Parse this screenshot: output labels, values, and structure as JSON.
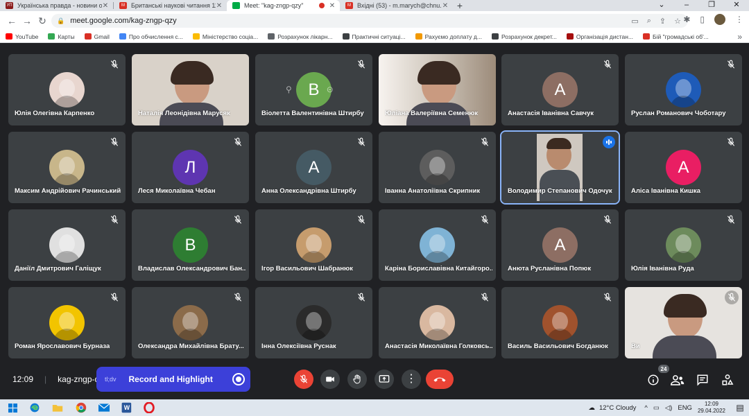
{
  "browser": {
    "tabs": [
      {
        "title": "Українська правда - новини он",
        "favicon_color": "#8b1a1a",
        "favicon_text": "УП",
        "active": false
      },
      {
        "title": "Британські наукові читання 11",
        "favicon_color": "#d93025",
        "favicon_text": "M",
        "active": false
      },
      {
        "title": "Meet: \"kag-zngp-qzy\"",
        "favicon_color": "#00ac47",
        "favicon_text": "",
        "active": true,
        "recording": true
      },
      {
        "title": "Вхідні (53) - m.marych@chnu.ed",
        "favicon_color": "#d93025",
        "favicon_text": "M",
        "active": false
      }
    ],
    "new_tab_label": "+",
    "url": "meet.google.com/kag-zngp-qzy",
    "bookmarks": [
      {
        "label": "YouTube",
        "color": "#ff0000"
      },
      {
        "label": "Карты",
        "color": "#34a853"
      },
      {
        "label": "Gmail",
        "color": "#d93025"
      },
      {
        "label": "Про обчислення с...",
        "color": "#4285f4"
      },
      {
        "label": "Міністерство соціа...",
        "color": "#fbbc04"
      },
      {
        "label": "Розрахунок лікарн...",
        "color": "#5f6368"
      },
      {
        "label": "Практичні ситуаці...",
        "color": "#3c4043"
      },
      {
        "label": "Рахуємо доплату д...",
        "color": "#f29900"
      },
      {
        "label": "Розрахунок декрет...",
        "color": "#3c4043"
      },
      {
        "label": "Організація дистан...",
        "color": "#a50e0e"
      },
      {
        "label": "Бій \"громадські об'...",
        "color": "#d93025"
      }
    ]
  },
  "participants": [
    {
      "name": "Юлія Олегівна Карпенко",
      "type": "photo",
      "color": "#e8d6cf",
      "muted": true
    },
    {
      "name": "Наталія Леонідівна Марусяк",
      "type": "video",
      "color": "#d9d2c9",
      "muted": false
    },
    {
      "name": "Віолетта Валентинівна Штирбу",
      "type": "avatar",
      "letter": "В",
      "color": "#6aa84f",
      "muted": true,
      "hover": true
    },
    {
      "name": "Юліана Валеріївна Семенюк",
      "type": "video",
      "color": "#d8d2cc",
      "muted": false
    },
    {
      "name": "Анастасія Іванівна Савчук",
      "type": "avatar",
      "letter": "А",
      "color": "#8d6e63",
      "muted": true
    },
    {
      "name": "Руслан Романович Чоботару",
      "type": "photo",
      "color": "#1e5bb8",
      "muted": true
    },
    {
      "name": "Максим Андрійович Рачинський",
      "type": "photo",
      "color": "#c8b68a",
      "muted": true
    },
    {
      "name": "Леся Миколаївна Чебан",
      "type": "avatar",
      "letter": "Л",
      "color": "#5e35b1",
      "muted": true
    },
    {
      "name": "Анна Олександрівна Штирбу",
      "type": "avatar",
      "letter": "А",
      "color": "#455a64",
      "muted": true
    },
    {
      "name": "Іванна Анатоліївна Скрипник",
      "type": "photo",
      "color": "#5d5d5d",
      "muted": true
    },
    {
      "name": "Володимир Степанович Одочук",
      "type": "video",
      "color": "#cfc8c0",
      "muted": false,
      "speaking": true
    },
    {
      "name": "Аліса Іванівна Кишка",
      "type": "avatar",
      "letter": "А",
      "color": "#e91e63",
      "muted": true
    },
    {
      "name": "Даніїл Дмитрович Галіщук",
      "type": "photo",
      "color": "#e0e0e0",
      "muted": true
    },
    {
      "name": "Владислав Олександрович Бан...",
      "type": "avatar",
      "letter": "В",
      "color": "#2e7d32",
      "muted": true
    },
    {
      "name": "Ігор Васильович Шабранюк",
      "type": "photo",
      "color": "#c69c6d",
      "muted": true
    },
    {
      "name": "Каріна Бориславівна Китайгоро...",
      "type": "photo",
      "color": "#7fb3d5",
      "muted": true
    },
    {
      "name": "Анюта Русланівна Попюк",
      "type": "avatar",
      "letter": "А",
      "color": "#8d6e63",
      "muted": true
    },
    {
      "name": "Юлія Іванівна Руда",
      "type": "photo",
      "color": "#6d8b5c",
      "muted": true
    },
    {
      "name": "Роман Ярославович Бурназа",
      "type": "photo",
      "color": "#f2c400",
      "muted": true
    },
    {
      "name": "Олександра Михайлівна Брату...",
      "type": "photo",
      "color": "#8b6b4a",
      "muted": true
    },
    {
      "name": "Інна Олексіївна Руснак",
      "type": "photo",
      "color": "#2b2b2b",
      "muted": true
    },
    {
      "name": "Анастасія Миколаївна Голковсь...",
      "type": "photo",
      "color": "#d9b8a0",
      "muted": true
    },
    {
      "name": "Василь Васильович Богданюк",
      "type": "photo",
      "color": "#a0522d",
      "muted": true
    },
    {
      "name": "Ви",
      "type": "video",
      "color": "#e6e3df",
      "muted": true
    }
  ],
  "meeting": {
    "time": "12:09",
    "code": "kag-zngp-q...",
    "record_prefix": "tl;dv",
    "record_label": "Record and Highlight",
    "people_count": "24"
  },
  "taskbar": {
    "weather": "12°C  Cloudy",
    "lang": "ENG",
    "clock_time": "12:09",
    "clock_date": "29.04.2022"
  }
}
